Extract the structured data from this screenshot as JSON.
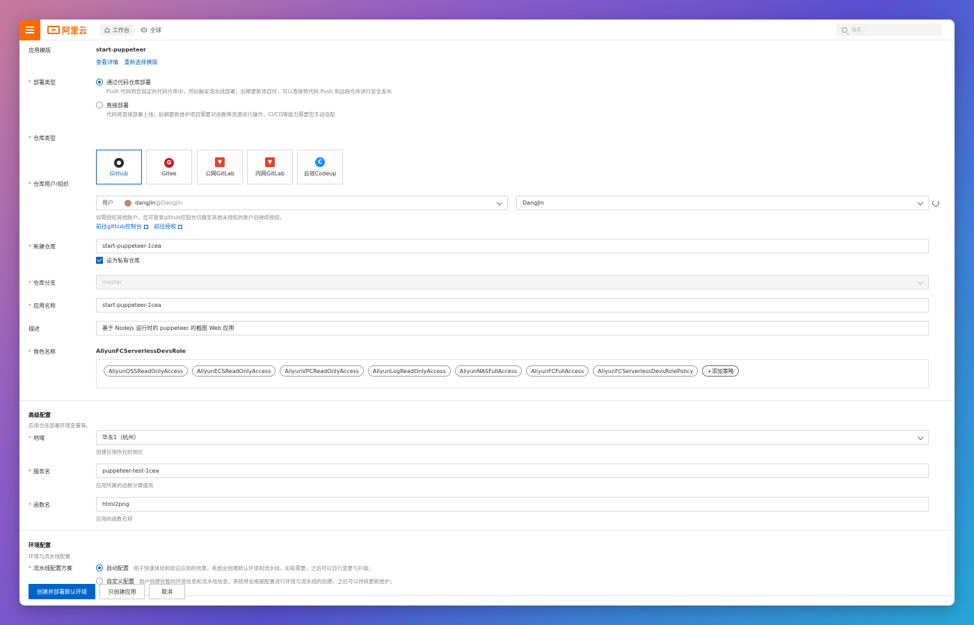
{
  "topbar": {
    "logo_text": "阿里云",
    "nav": [
      {
        "label": "工作台",
        "icon": "home-icon"
      },
      {
        "label": "全球",
        "icon": "globe-icon"
      }
    ],
    "search_placeholder": "搜索..."
  },
  "template": {
    "label": "应用模版",
    "value": "start-puppeteer",
    "links": [
      "查看详情",
      "重新选择模版"
    ]
  },
  "deploy_type": {
    "label": "部署类型",
    "options": [
      {
        "label": "通过代码仓库部署",
        "desc": "Push 代码到您指定的代码仓库中，然后触发流水线部署；后期更新项目时，可以直接将代码 Push 到远程仓库进行安全发布",
        "selected": true
      },
      {
        "label": "直接部署",
        "desc": "代码将直接部署上线；后期更新维护项目需要对函数等资源进行操作，CI/CD等能力需要您手动适配",
        "selected": false
      }
    ]
  },
  "repo_type": {
    "label": "仓库类型",
    "options": [
      "Github",
      "Gitee",
      "公网GitLab",
      "内网GitLab",
      "云效Codeup"
    ],
    "selected": "Github"
  },
  "repo_owner": {
    "label": "仓库用户/组织",
    "user_prefix": "用户",
    "user_name": "dangjin",
    "user_suffix": "@DangJin",
    "org_value": "DangJin",
    "hint": "如需授权其他账户，您可登录github控制台切换至其他未授权的账户后继续授权。",
    "links": [
      "前往github控制台",
      "前往授权"
    ]
  },
  "new_repo": {
    "label": "新建仓库",
    "value": "start-puppeteer-1cea",
    "private_label": "设为私有仓库",
    "private_checked": true
  },
  "branch": {
    "label": "仓库分支",
    "value": "master"
  },
  "app_name": {
    "label": "应用名称",
    "value": "start-puppeteer-1cea"
  },
  "description": {
    "label": "描述",
    "value": "基于 Nodejs 运行时的 puppeteer 的截图 Web 应用"
  },
  "role": {
    "label": "角色名称",
    "value": "AliyunFCServerlessDevsRole",
    "policies": [
      "AliyunOSSReadOnlyAccess",
      "AliyunECSReadOnlyAccess",
      "AliyunVPCReadOnlyAccess",
      "AliyunLogReadOnlyAccess",
      "AliyunNASFullAccess",
      "AliyunFCFullAccess",
      "AliyunFCServerlessDevsRolePolicy"
    ],
    "add_policy": "+添加策略"
  },
  "advanced": {
    "title": "高级配置",
    "subtitle": "应用仓库部署环境变量等。",
    "region": {
      "label": "地域",
      "value": "华东1（杭州）",
      "hint": "创建应用所在的地区"
    },
    "service": {
      "label": "服务名",
      "value": "puppeteer-test-1cea",
      "hint": "应用所属的函数计算服务"
    },
    "function": {
      "label": "函数名",
      "value": "html2png",
      "hint": "应用的函数名称"
    }
  },
  "env": {
    "title": "环境配置",
    "subtitle": "环境与流水线配置",
    "pipeline_label": "流水线配置方案",
    "options": [
      {
        "label": "自动配置",
        "desc": "用于快速体验和验证应用的效果，系统会创建默认环境和流水线，如有需要，之后可以自行变更与升级；",
        "selected": true
      },
      {
        "label": "自定义配置",
        "desc": "用户创建完整的环境信息和流水线信息，系统将会根据配置进行环境与流水线的创建，之后可以持续更新维护；",
        "selected": false
      }
    ]
  },
  "actions": {
    "primary": "创建并部署默认环境",
    "create_only": "只创建应用",
    "cancel": "取消"
  },
  "colors": {
    "accent": "#0064c8",
    "brand": "#ff6a00"
  }
}
